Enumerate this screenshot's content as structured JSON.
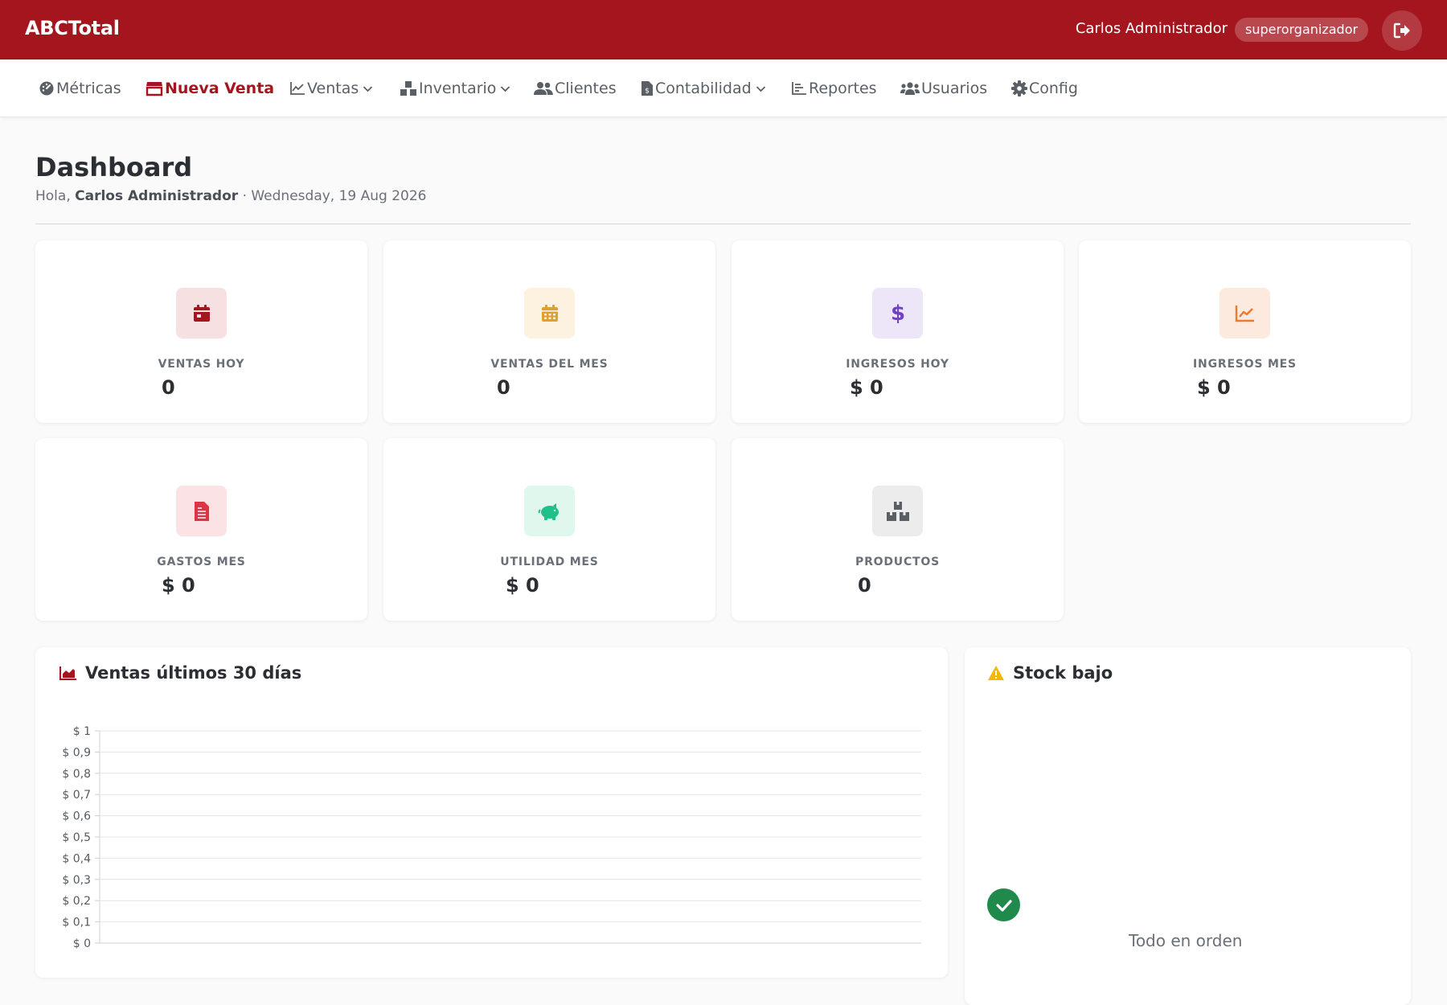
{
  "header": {
    "brand": "ABCTotal",
    "user_name": "Carlos Administrador",
    "role_badge": "superorganizador",
    "logout_icon": "sign-out-icon"
  },
  "nav": {
    "items": [
      {
        "label": "Métricas",
        "icon": "gauge-icon"
      },
      {
        "label": "Nueva Venta",
        "icon": "store-icon",
        "active": true
      },
      {
        "label": "Ventas",
        "icon": "line-chart-icon",
        "dropdown": true
      },
      {
        "label": "Inventario",
        "icon": "boxes-icon",
        "dropdown": true
      },
      {
        "label": "Clientes",
        "icon": "users-icon"
      },
      {
        "label": "Contabilidad",
        "icon": "invoice-icon",
        "dropdown": true
      },
      {
        "label": "Reportes",
        "icon": "report-icon"
      },
      {
        "label": "Usuarios",
        "icon": "users-group-icon"
      },
      {
        "label": "Config",
        "icon": "gear-icon"
      }
    ]
  },
  "page": {
    "title": "Dashboard",
    "greeting_prefix": "Hola,",
    "greeting_name": "Carlos Administrador",
    "greeting_date": "· Wednesday, 19 Aug 2026"
  },
  "cards": [
    {
      "label": "VENTAS HOY",
      "value": "0",
      "icon": "calendar-icon",
      "color": "#a5151d",
      "bg": "#f6e0e1"
    },
    {
      "label": "VENTAS DEL MES",
      "value": "0",
      "icon": "calendar-grid-icon",
      "color": "#e0a030",
      "bg": "#fdf1e0"
    },
    {
      "label": "INGRESOS HOY",
      "value": "$ 0",
      "icon": "dollar-icon",
      "color": "#6f42c1",
      "bg": "#ece6f8"
    },
    {
      "label": "INGRESOS MES",
      "value": "$ 0",
      "icon": "area-chart-icon",
      "color": "#f0782c",
      "bg": "#fdeadf"
    },
    {
      "label": "GASTOS MES",
      "value": "$ 0",
      "icon": "file-invoice-icon",
      "color": "#dc3545",
      "bg": "#fbe2e4"
    },
    {
      "label": "UTILIDAD MES",
      "value": "$ 0",
      "icon": "piggy-bank-icon",
      "color": "#20c08a",
      "bg": "#e0f7ee"
    },
    {
      "label": "PRODUCTOS",
      "value": "0",
      "icon": "boxes-icon",
      "color": "#5a5f66",
      "bg": "#ececec"
    }
  ],
  "sales_panel": {
    "title": "Ventas últimos 30 días",
    "icon": "area-chart-icon"
  },
  "stock_panel": {
    "title": "Stock bajo",
    "icon": "warning-icon",
    "empty_text": "Todo en orden",
    "empty_icon": "check-circle-icon"
  },
  "chart_data": {
    "type": "line",
    "title": "Ventas últimos 30 días",
    "xlabel": "",
    "ylabel": "",
    "ylim": [
      0,
      1
    ],
    "y_ticks": [
      1,
      0.9,
      0.8,
      0.7,
      0.6,
      0.5,
      0.4,
      0.3,
      0.2,
      0.1,
      0
    ],
    "y_tick_labels": [
      "$ 1",
      "$ 0,9",
      "$ 0,8",
      "$ 0,7",
      "$ 0,6",
      "$ 0,5",
      "$ 0,4",
      "$ 0,3",
      "$ 0,2",
      "$ 0,1",
      "$ 0"
    ],
    "x": [],
    "series": [],
    "grid": true
  }
}
